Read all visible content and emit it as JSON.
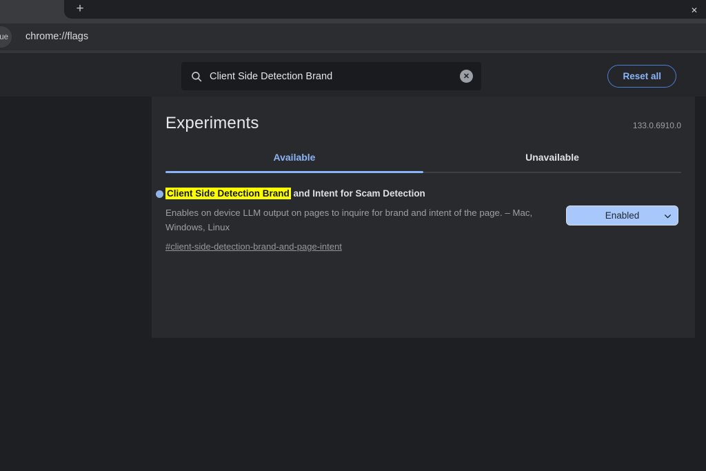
{
  "browser": {
    "tab_close_icon": "✕",
    "new_tab_icon": "+",
    "url": "chrome://flags",
    "badge_text": "ue"
  },
  "header": {
    "search_value": "Client Side Detection Brand",
    "clear_icon": "✕",
    "reset_all_label": "Reset all"
  },
  "experiments": {
    "title": "Experiments",
    "version": "133.0.6910.0",
    "tabs": [
      {
        "label": "Available",
        "selected": true
      },
      {
        "label": "Unavailable",
        "selected": false
      }
    ],
    "flag": {
      "title_highlight": "Client Side Detection Brand",
      "title_rest": " and Intent for Scam Detection",
      "description": "Enables on device LLM output on pages to inquire for brand and intent of the page. – Mac, Windows, Linux",
      "link": "#client-side-detection-brand-and-page-intent",
      "select_value": "Enabled"
    }
  },
  "colors": {
    "accent_blue": "#8ab4f8",
    "highlight_yellow": "#fdff00",
    "select_bg": "#a8c7fa",
    "panel_bg": "#292a2e",
    "page_bg": "#1e1f23"
  }
}
